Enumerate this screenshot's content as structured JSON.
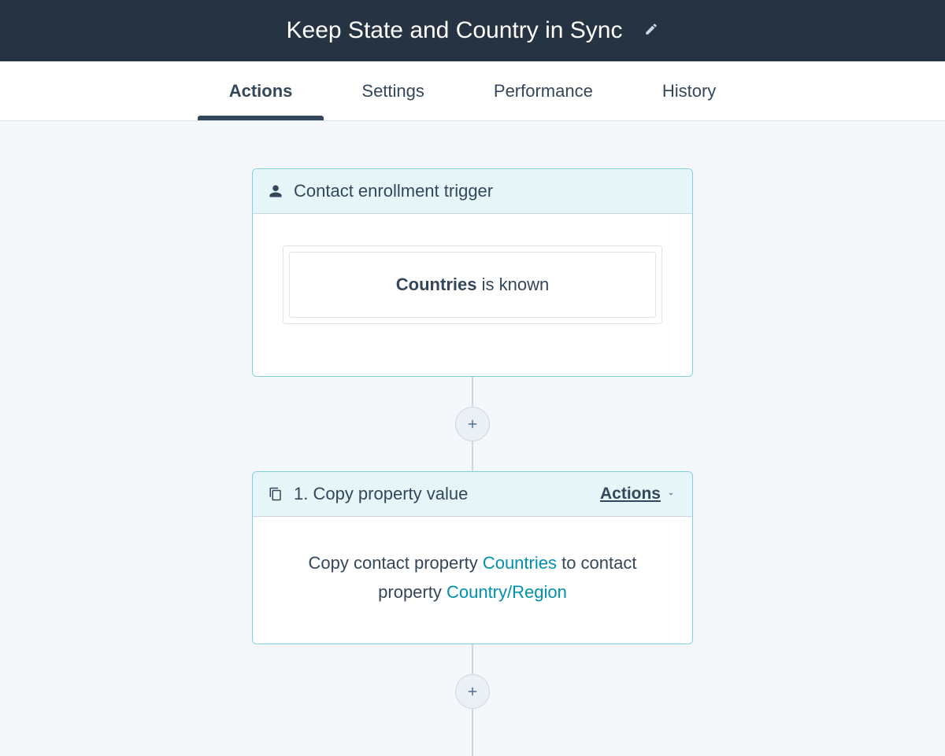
{
  "header": {
    "title": "Keep State and Country in Sync"
  },
  "tabs": [
    {
      "label": "Actions",
      "active": true
    },
    {
      "label": "Settings",
      "active": false
    },
    {
      "label": "Performance",
      "active": false
    },
    {
      "label": "History",
      "active": false
    }
  ],
  "trigger_card": {
    "title": "Contact enrollment trigger",
    "filter_property": "Countries",
    "filter_condition": " is known"
  },
  "action_card": {
    "title": "1. Copy property value",
    "actions_label": "Actions",
    "description": {
      "prefix": "Copy contact property ",
      "source_property": "Countries",
      "middle": " to contact property ",
      "target_property": "Country/Region"
    }
  }
}
